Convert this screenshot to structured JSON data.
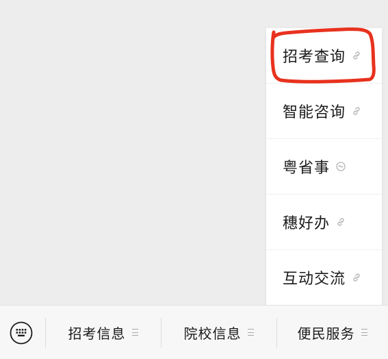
{
  "popup_menu": {
    "items": [
      {
        "label": "招考查询",
        "icon": "link-icon"
      },
      {
        "label": "智能咨询",
        "icon": "link-icon"
      },
      {
        "label": "粤省事",
        "icon": "mini-program-icon"
      },
      {
        "label": "穗好办",
        "icon": "link-icon"
      },
      {
        "label": "互动交流",
        "icon": "link-icon"
      }
    ]
  },
  "bottom_bar": {
    "keyboard_icon": "keyboard-icon",
    "tabs": [
      {
        "label": "招考信息",
        "icon": "menu-lines-icon"
      },
      {
        "label": "院校信息",
        "icon": "menu-lines-icon"
      },
      {
        "label": "便民服务",
        "icon": "menu-lines-icon"
      }
    ]
  },
  "annotation": {
    "color": "#e8321e",
    "target": "招考查询"
  },
  "colors": {
    "background": "#ededed",
    "menu_background": "#ffffff",
    "bar_background": "#f7f7f7",
    "text": "#1a1a1a",
    "icon_gray": "#b5b5b5"
  }
}
